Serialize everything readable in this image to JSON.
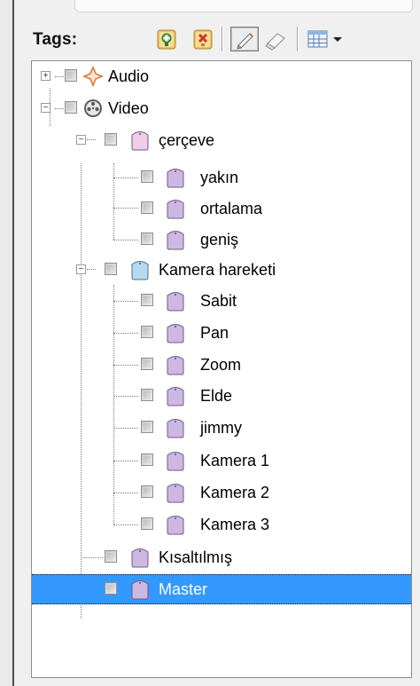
{
  "panel": {
    "tags_label": "Tags:"
  },
  "toolbar": {
    "icons": [
      "add-tag-icon",
      "remove-tag-icon",
      "pencil-icon",
      "eraser-icon",
      "list-view-icon",
      "dropdown-arrow-icon"
    ]
  },
  "tree": {
    "audio": "Audio",
    "video": "Video",
    "cerceve": "çerçeve",
    "yakin": "yakın",
    "ortalama": "ortalama",
    "genis": "geniş",
    "kamera_hareketi": "Kamera hareketi",
    "sabit": "Sabit",
    "pan": "Pan",
    "zoom": "Zoom",
    "elde": "Elde",
    "jimmy": "jimmy",
    "kamera1": "Kamera 1",
    "kamera2": "Kamera 2",
    "kamera3": "Kamera 3",
    "kisaltilmis": "Kısaltılmış",
    "master": "Master",
    "selected": "Master"
  },
  "colors": {
    "selection": "#3399ff",
    "tag_purple": "#cdb8e4",
    "tag_pink": "#f1cdea",
    "tag_blue": "#b5daef"
  }
}
